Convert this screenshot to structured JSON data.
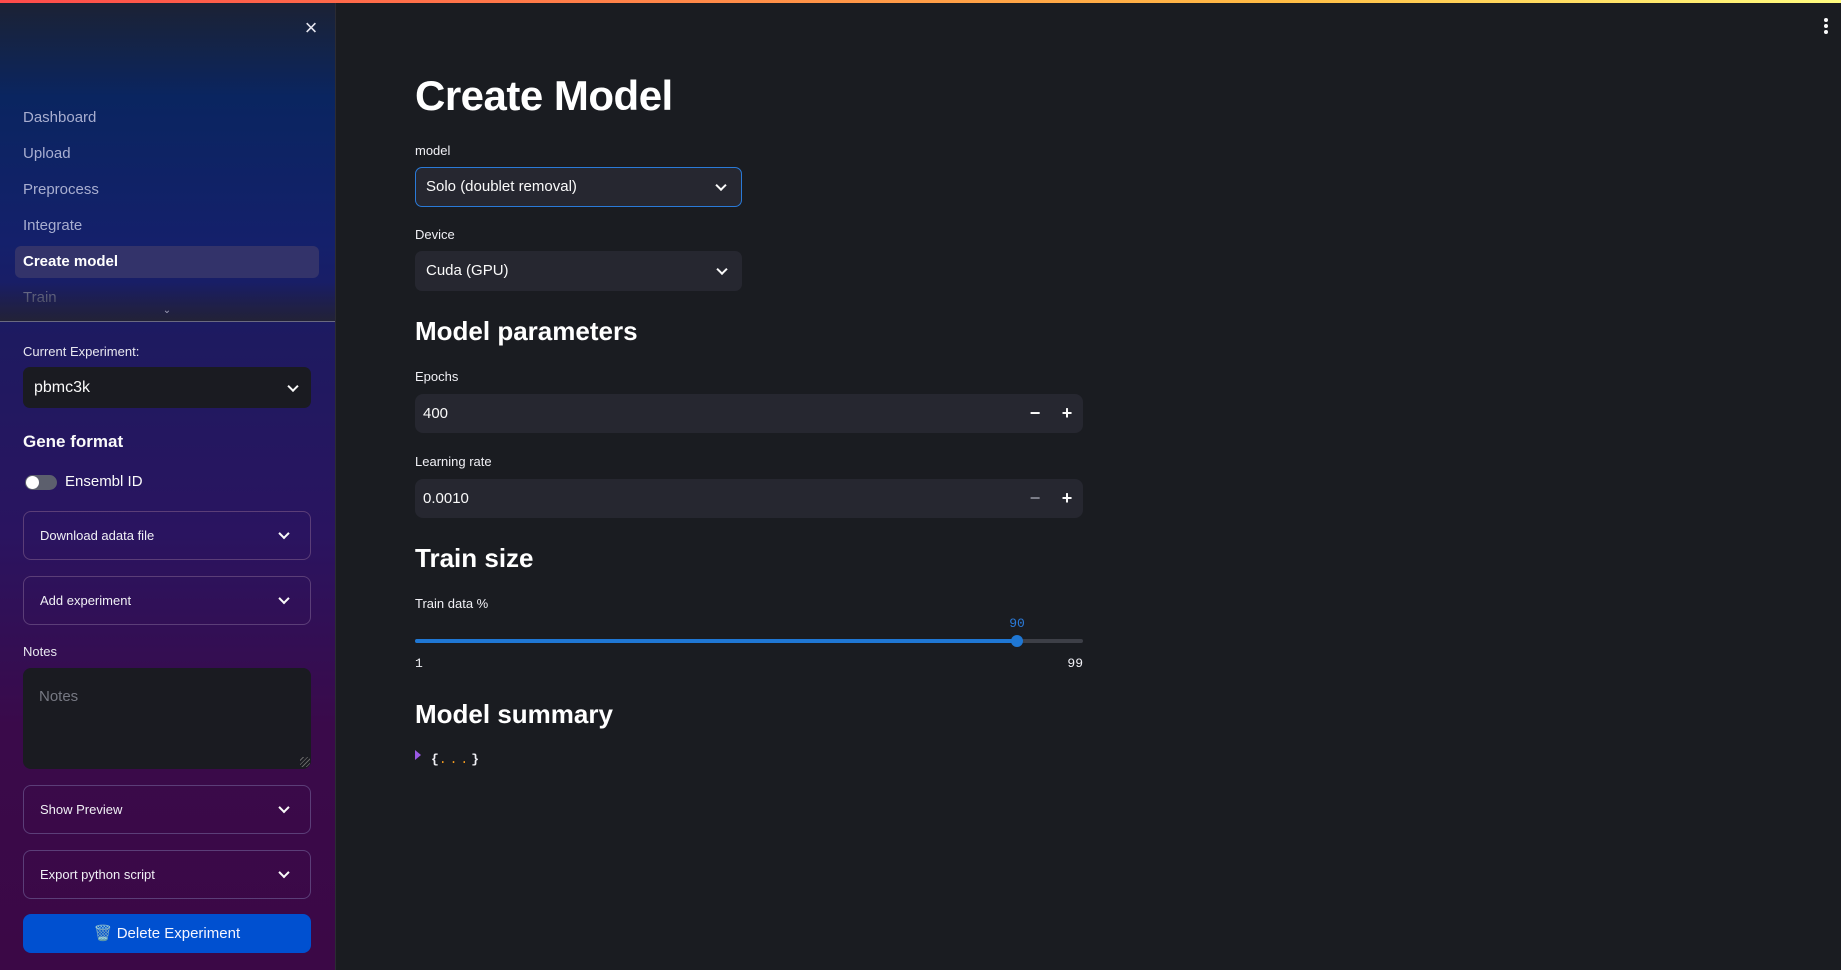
{
  "sidebar": {
    "close_icon": "×",
    "nav_items": [
      {
        "label": "Dashboard",
        "active": false
      },
      {
        "label": "Upload",
        "active": false
      },
      {
        "label": "Preprocess",
        "active": false
      },
      {
        "label": "Integrate",
        "active": false
      },
      {
        "label": "Create model",
        "active": true
      },
      {
        "label": "Train",
        "active": false
      }
    ],
    "nav_expand_icon": "⌄",
    "experiment_label": "Current Experiment:",
    "experiment_value": "pbmc3k",
    "gene_format_heading": "Gene format",
    "ensembl_toggle_label": "Ensembl ID",
    "ensembl_toggle_on": false,
    "expanders": {
      "download": "Download adata file",
      "add_experiment": "Add experiment",
      "show_preview": "Show Preview",
      "export_script": "Export python script"
    },
    "notes_label": "Notes",
    "notes_placeholder": "Notes",
    "delete_button": "🗑️ Delete Experiment"
  },
  "main": {
    "title": "Create Model",
    "model_label": "model",
    "model_value": "Solo (doublet removal)",
    "device_label": "Device",
    "device_value": "Cuda (GPU)",
    "params_heading": "Model parameters",
    "epochs_label": "Epochs",
    "epochs_value": "400",
    "lr_label": "Learning rate",
    "lr_value": "0.0010",
    "step_minus": "−",
    "step_plus": "+",
    "train_size_heading": "Train size",
    "train_data_label": "Train data %",
    "train_data_value": 90,
    "train_data_min": 1,
    "train_data_max": 99,
    "summary_heading": "Model summary",
    "summary_open_brace": "{",
    "summary_ellipsis": "...",
    "summary_close_brace": "}"
  },
  "colors": {
    "accent": "#1f77d4",
    "delete_button": "#0050d0",
    "main_bg": "#1a1c21"
  }
}
